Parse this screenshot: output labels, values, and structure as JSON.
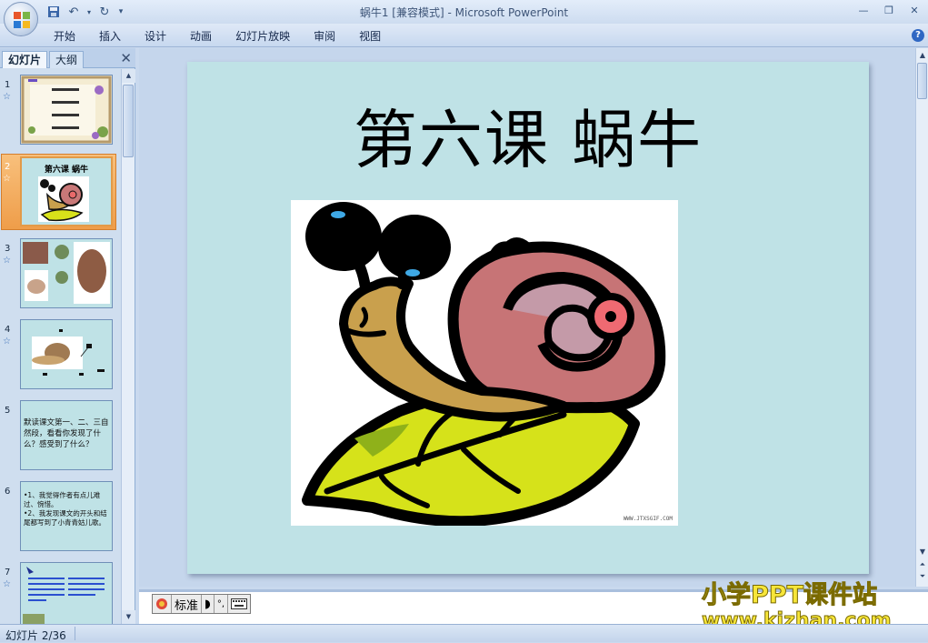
{
  "window": {
    "title": "蜗牛1 [兼容模式] - Microsoft PowerPoint"
  },
  "ribbon": {
    "tabs": [
      "开始",
      "插入",
      "设计",
      "动画",
      "幻灯片放映",
      "审阅",
      "视图"
    ]
  },
  "left_panel": {
    "tab_slides": "幻灯片",
    "tab_outline": "大纲",
    "slides": [
      {
        "number": "1",
        "text": "",
        "has_animation": true
      },
      {
        "number": "2",
        "text": "第六课 蜗牛",
        "has_animation": true,
        "selected": true
      },
      {
        "number": "3",
        "text": "",
        "has_animation": true
      },
      {
        "number": "4",
        "text": "",
        "has_animation": true
      },
      {
        "number": "5",
        "text": "默读课文第一、二、三自然段，看看你发现了什么？感受到了什么？",
        "has_animation": false
      },
      {
        "number": "6",
        "text": "•1、我觉得作者有点儿难过、惋惜。\n•2、我发现课文的开头和结尾都写到了小青青姑儿歌。",
        "has_animation": false
      },
      {
        "number": "7",
        "text": "",
        "has_animation": true
      }
    ]
  },
  "slide": {
    "title": "第六课 蜗牛",
    "image_watermark": "WWW.JTXSGIF.COM"
  },
  "notes": {
    "ime_mode": "标准"
  },
  "brand": {
    "line1": "小学PPT课件站",
    "line2": "www.kjzhan.com"
  },
  "status": {
    "slide_indicator": "幻灯片 2/36"
  },
  "colors": {
    "slide_background": "#bfe2e6",
    "selected_thumbnail": "#ef9d49",
    "brand_text": "#f7e63a"
  }
}
